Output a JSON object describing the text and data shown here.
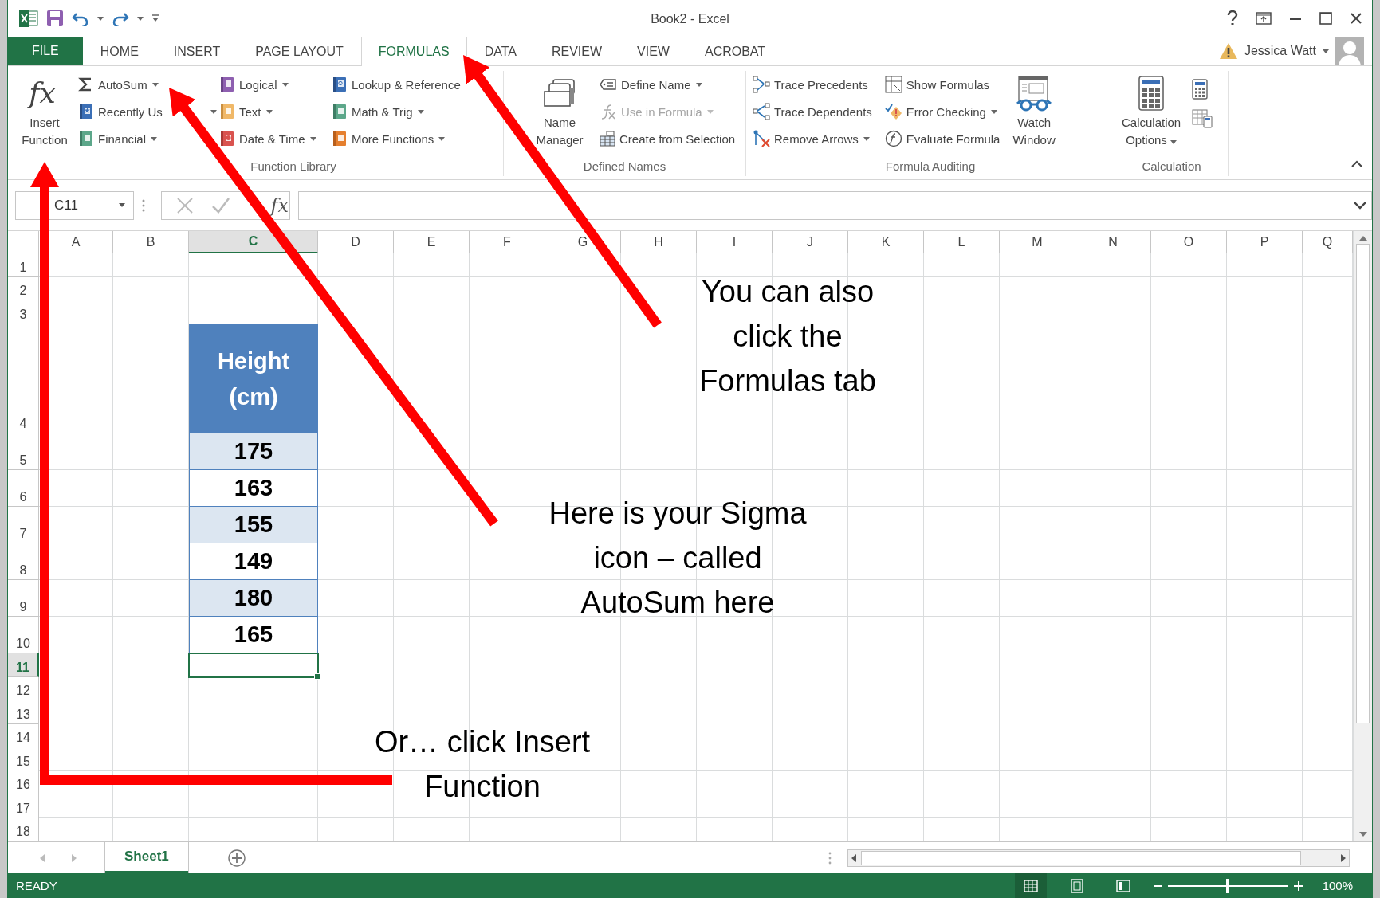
{
  "window": {
    "title": "Book2 - Excel",
    "user": "Jessica Watt"
  },
  "tabs": [
    {
      "label": "FILE",
      "kind": "file",
      "selected": false
    },
    {
      "label": "HOME",
      "kind": "tab",
      "selected": false
    },
    {
      "label": "INSERT",
      "kind": "tab",
      "selected": false
    },
    {
      "label": "PAGE LAYOUT",
      "kind": "tab",
      "selected": false
    },
    {
      "label": "FORMULAS",
      "kind": "tab",
      "selected": true
    },
    {
      "label": "DATA",
      "kind": "tab",
      "selected": false
    },
    {
      "label": "REVIEW",
      "kind": "tab",
      "selected": false
    },
    {
      "label": "VIEW",
      "kind": "tab",
      "selected": false
    },
    {
      "label": "ACROBAT",
      "kind": "tab",
      "selected": false
    }
  ],
  "ribbon": {
    "groups": [
      {
        "label": "Function Library",
        "items": [
          {
            "kind": "large",
            "glyph": "fx",
            "lines": [
              "Insert",
              "Function"
            ],
            "has_menu": false,
            "disabled": false
          },
          {
            "kind": "column",
            "buttons": [
              {
                "label": "AutoSum",
                "has_menu": true,
                "disabled": false
              },
              {
                "label": "Recently Us",
                "has_menu": true,
                "disabled": false
              },
              {
                "label": "Financial",
                "has_menu": true,
                "disabled": false
              }
            ]
          },
          {
            "kind": "column",
            "buttons": [
              {
                "label": "Logical",
                "has_menu": true,
                "disabled": false
              },
              {
                "label": "Text",
                "has_menu": true,
                "disabled": false
              },
              {
                "label": "Date & Time",
                "has_menu": true,
                "disabled": false
              }
            ]
          },
          {
            "kind": "column",
            "buttons": [
              {
                "label": "Lookup & Reference",
                "has_menu": false,
                "disabled": false
              },
              {
                "label": "Math & Trig",
                "has_menu": true,
                "disabled": false
              },
              {
                "label": "More Functions",
                "has_menu": true,
                "disabled": false
              }
            ]
          }
        ]
      },
      {
        "label": "Defined Names",
        "items": [
          {
            "kind": "large",
            "lines": [
              "Name",
              "Manager"
            ],
            "has_menu": false,
            "disabled": false
          },
          {
            "kind": "column",
            "buttons": [
              {
                "label": "Define Name",
                "has_menu": true,
                "disabled": false
              },
              {
                "label": "Use in Formula",
                "has_menu": true,
                "disabled": true
              },
              {
                "label": "Create from Selection",
                "has_menu": false,
                "disabled": false
              }
            ]
          }
        ]
      },
      {
        "label": "Formula Auditing",
        "items": [
          {
            "kind": "column",
            "buttons": [
              {
                "label": "Trace Precedents",
                "has_menu": false,
                "disabled": false
              },
              {
                "label": "Trace Dependents",
                "has_menu": false,
                "disabled": false
              },
              {
                "label": "Remove Arrows",
                "has_menu": true,
                "disabled": false
              }
            ]
          },
          {
            "kind": "column",
            "buttons": [
              {
                "label": "Show Formulas",
                "has_menu": false,
                "disabled": false
              },
              {
                "label": "Error Checking",
                "has_menu": true,
                "disabled": false
              },
              {
                "label": "Evaluate Formula",
                "has_menu": false,
                "disabled": false
              }
            ]
          },
          {
            "kind": "large",
            "lines": [
              "Watch",
              "Window"
            ],
            "has_menu": false,
            "disabled": false
          }
        ]
      },
      {
        "label": "Calculation",
        "items": [
          {
            "kind": "large",
            "lines": [
              "Calculation",
              "Options"
            ],
            "has_menu": true,
            "disabled": false
          },
          {
            "kind": "icon_column"
          }
        ]
      }
    ]
  },
  "formula_bar": {
    "name_box": "C11",
    "glyph": "fx"
  },
  "sheet": {
    "columns": [
      {
        "label": "A",
        "selected": false
      },
      {
        "label": "B",
        "selected": false
      },
      {
        "label": "C",
        "selected": true
      },
      {
        "label": "D",
        "selected": false
      },
      {
        "label": "E",
        "selected": false
      },
      {
        "label": "F",
        "selected": false
      },
      {
        "label": "G",
        "selected": false
      },
      {
        "label": "H",
        "selected": false
      },
      {
        "label": "I",
        "selected": false
      },
      {
        "label": "J",
        "selected": false
      },
      {
        "label": "K",
        "selected": false
      },
      {
        "label": "L",
        "selected": false
      },
      {
        "label": "M",
        "selected": false
      },
      {
        "label": "N",
        "selected": false
      },
      {
        "label": "O",
        "selected": false
      },
      {
        "label": "P",
        "selected": false
      },
      {
        "label": "Q",
        "selected": false
      }
    ],
    "rows": [
      {
        "label": "1",
        "selected": false
      },
      {
        "label": "2",
        "selected": false
      },
      {
        "label": "3",
        "selected": false
      },
      {
        "label": "4",
        "selected": false
      },
      {
        "label": "5",
        "selected": false
      },
      {
        "label": "6",
        "selected": false
      },
      {
        "label": "7",
        "selected": false
      },
      {
        "label": "8",
        "selected": false
      },
      {
        "label": "9",
        "selected": false
      },
      {
        "label": "10",
        "selected": false
      },
      {
        "label": "11",
        "selected": true
      },
      {
        "label": "12",
        "selected": false
      },
      {
        "label": "13",
        "selected": false
      },
      {
        "label": "14",
        "selected": false
      },
      {
        "label": "15",
        "selected": false
      },
      {
        "label": "16",
        "selected": false
      },
      {
        "label": "17",
        "selected": false
      },
      {
        "label": "18",
        "selected": false
      }
    ],
    "table": {
      "header_lines": [
        "Height",
        "(cm)"
      ],
      "values": [
        "175",
        "163",
        "155",
        "149",
        "180",
        "165"
      ]
    }
  },
  "sheet_tabs": [
    {
      "label": "Sheet1",
      "selected": true
    }
  ],
  "status_bar": {
    "status": "READY",
    "views": [
      {
        "kind": "normal",
        "selected": true
      },
      {
        "kind": "page_layout",
        "selected": false
      },
      {
        "kind": "page_break",
        "selected": false
      }
    ],
    "zoom": {
      "level": 0.5,
      "reading": "100%"
    }
  },
  "annotations": [
    {
      "lines": [
        "You can also",
        "click the",
        "Formulas tab"
      ]
    },
    {
      "lines": [
        "Here is your Sigma",
        "icon – called",
        "AutoSum here"
      ]
    },
    {
      "lines": [
        "Or… click Insert",
        "Function"
      ]
    }
  ]
}
